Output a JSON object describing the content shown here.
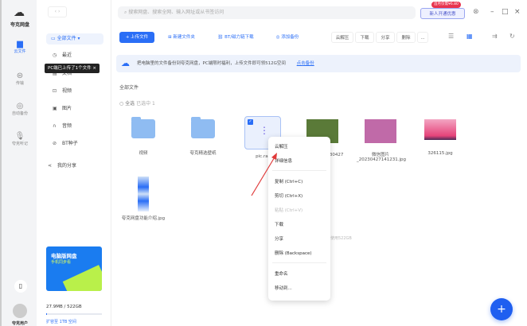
{
  "app": {
    "brand": "夸克网盘",
    "user": "夸克用户"
  },
  "rail": [
    {
      "label": "云文件",
      "icon": "cloud-folder-icon"
    },
    {
      "label": "传输",
      "icon": "transfer-icon"
    },
    {
      "label": "自动备份",
      "icon": "backup-icon"
    },
    {
      "label": "夸克听记",
      "icon": "mic-icon"
    }
  ],
  "sidebar": {
    "all_files": "全部文件",
    "items": [
      {
        "label": "最近",
        "icon": "clock-icon"
      },
      {
        "label": "文档",
        "icon": "doc-icon"
      },
      {
        "label": "视频",
        "icon": "video-icon"
      },
      {
        "label": "图片",
        "icon": "image-icon"
      },
      {
        "label": "音频",
        "icon": "headphones-icon"
      },
      {
        "label": "BT种子",
        "icon": "link-icon"
      }
    ],
    "my_share": "我的分享",
    "tooltip": "PC端已上传了1个文件",
    "promo_title": "电脑版网盘",
    "promo_sub": "手机同步看",
    "storage": "27.9MB / 522GB",
    "storage_fraction": 0.0001,
    "storage_link": "扩容至 1TB 空间"
  },
  "top": {
    "search_placeholder": "搜索网盘、搜索全网、输入网址或从书签访问",
    "vip_badge": "首月仅需¥6.80",
    "vip_button": "新人开通优惠"
  },
  "toolbar": {
    "upload": "上传文件",
    "new_folder": "新建文件夹",
    "bt_download": "BT/磁力链下载",
    "add_backup": "添加备份",
    "actions": [
      "云解压",
      "下载",
      "分享",
      "删除",
      "..."
    ]
  },
  "banner": {
    "text": "把电脑里的文件备份到夸克网盘，PC端限时福利，上传文件即可领512G空间",
    "link": "点击备份"
  },
  "main": {
    "breadcrumb": "全部文件",
    "select_all": "全选",
    "selected": "已选中 1",
    "storage_hint": "已使用522GB"
  },
  "files": [
    {
      "name": "视频",
      "type": "folder"
    },
    {
      "name": "夸克精选壁纸",
      "type": "folder"
    },
    {
      "name": "pic.rar",
      "type": "archive"
    },
    {
      "name": "微信图片_20230427 ...jpg",
      "type": "image"
    },
    {
      "name": "微信图片_20230427141231.jpg",
      "type": "image"
    },
    {
      "name": "326115.jpg",
      "type": "image"
    },
    {
      "name": "夸克网盘功能介绍.jpg",
      "type": "image"
    }
  ],
  "context_menu": [
    "云解压",
    "详细信息",
    "复制 (Ctrl+C)",
    "剪切 (Ctrl+X)",
    "粘贴 (Ctrl+V)",
    "下载",
    "分享",
    "删除 (Backspace)",
    "重命名",
    "移动到..."
  ],
  "colors": {
    "accent": "#2a6ef6",
    "vip": "#e8344e"
  }
}
